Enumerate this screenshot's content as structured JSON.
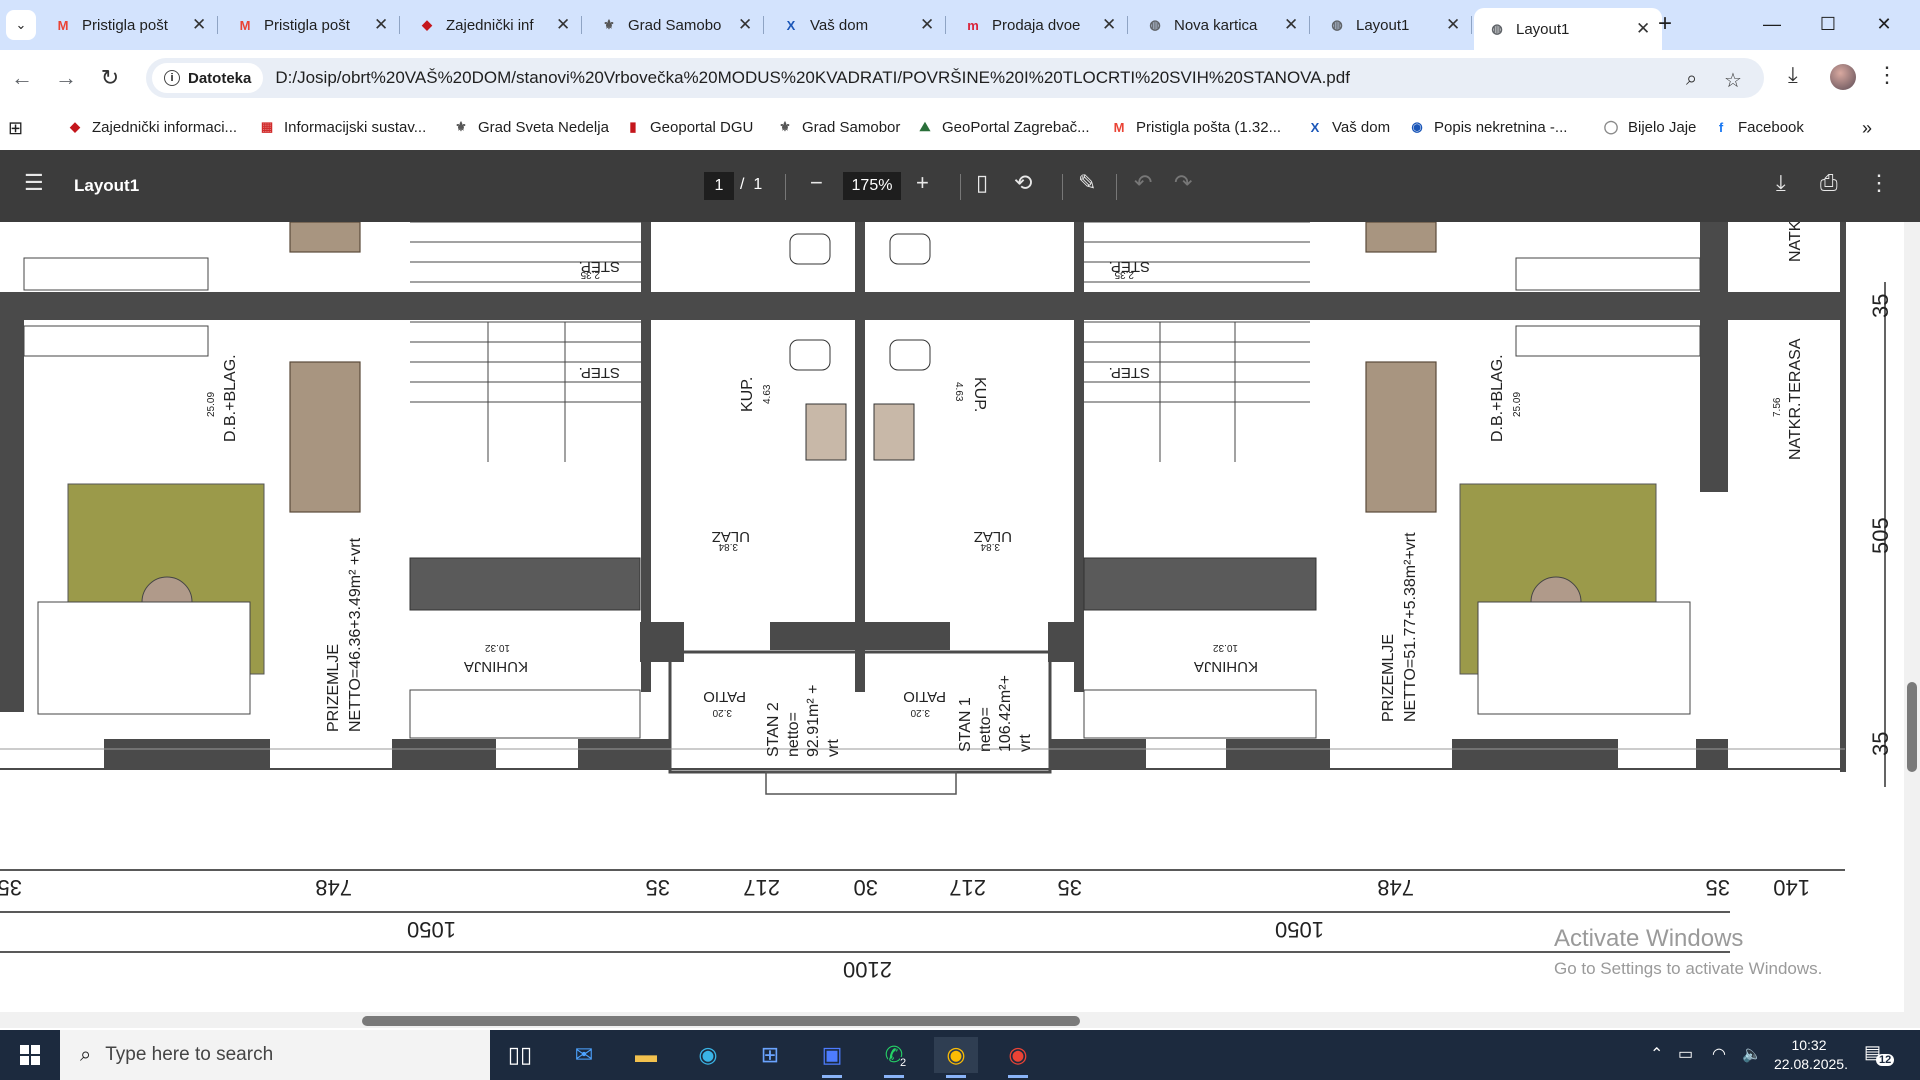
{
  "browser": {
    "tabs": [
      {
        "title": "Pristigla pošt",
        "icon": "gmail-icon",
        "color": "#ea4335"
      },
      {
        "title": "Pristigla pošt",
        "icon": "gmail-icon",
        "color": "#ea4335"
      },
      {
        "title": "Zajednički inf",
        "icon": "document-icon",
        "color": "#c4161c"
      },
      {
        "title": "Grad Samobo",
        "icon": "crest-icon",
        "color": "#555555"
      },
      {
        "title": "Vaš dom",
        "icon": "x-logo-icon",
        "color": "#1a56b8"
      },
      {
        "title": "Prodaja dvoe",
        "icon": "m-logo-icon",
        "color": "#d9233a"
      },
      {
        "title": "Nova kartica",
        "icon": "globe-icon",
        "color": "#5f6368"
      },
      {
        "title": "Layout1",
        "icon": "globe-icon",
        "color": "#5f6368"
      },
      {
        "title": "Layout1",
        "icon": "globe-icon",
        "color": "#5f6368",
        "active": true
      }
    ],
    "address": {
      "scheme_label": "Datoteka",
      "url": "D:/Josip/obrt%20VAŠ%20DOM/stanovi%20Vrbovečka%20MODUS%20KVADRATI/POVRŠINE%20I%20TLOCRTI%20SVIH%20STANOVA.pdf"
    },
    "bookmarks": [
      {
        "label": "Zajednički informaci...",
        "icon": "document-icon",
        "color": "#c4161c"
      },
      {
        "label": "Informacijski sustav...",
        "icon": "checkered-icon",
        "color": "#d12b2b"
      },
      {
        "label": "Grad Sveta Nedelja",
        "icon": "crest-icon",
        "color": "#555555"
      },
      {
        "label": "Geoportal DGU",
        "icon": "flag-icon",
        "color": "#c4161c"
      },
      {
        "label": "Grad Samobor",
        "icon": "crest-icon",
        "color": "#555555"
      },
      {
        "label": "GeoPortal Zagrebač...",
        "icon": "map-icon",
        "color": "#2a6f3a"
      },
      {
        "label": "Pristigla pošta (1.32...",
        "icon": "gmail-icon",
        "color": "#ea4335"
      },
      {
        "label": "Vaš dom",
        "icon": "x-logo-icon",
        "color": "#1a56b8"
      },
      {
        "label": "Popis nekretnina -...",
        "icon": "location-icon",
        "color": "#1a56b8"
      },
      {
        "label": "Bijelo Jaje",
        "icon": "egg-icon",
        "color": "#8a8a8a"
      },
      {
        "label": "Facebook",
        "icon": "facebook-icon",
        "color": "#1877f2"
      }
    ]
  },
  "pdf": {
    "title": "Layout1",
    "page_current": "1",
    "page_sep": "/",
    "page_total": "1",
    "zoom": "175%"
  },
  "plan": {
    "left_unit": {
      "stair_label": "STEP.",
      "stair_area": "2.35",
      "dining_label": "D.B.+BLAG.",
      "dining_area": "25.09",
      "bath_label": "KUP.",
      "bath_area": "4.63",
      "entry_label": "ULAZ",
      "entry_area": "3.84",
      "kitchen_label": "KUHINJA",
      "kitchen_area": "10.32",
      "patio_label": "PATIO",
      "patio_area": "3.20",
      "floor_label": "PRIZEMLJE",
      "netto": "NETTO=46.36+3.49m² +vrt",
      "stan_name": "STAN 2",
      "stan_netto": "netto=",
      "stan_area": "92.91m² +",
      "stan_vrt": "vrt"
    },
    "right_unit": {
      "stair_label": "STEP.",
      "stair_area": "2.35",
      "dining_label": "D.B.+BLAG.",
      "dining_area": "25.09",
      "bath_label": "KUP.",
      "bath_area": "4.63",
      "entry_label": "ULAZ",
      "entry_area": "3.84",
      "kitchen_label": "KUHINJA",
      "kitchen_area": "10.32",
      "patio_label": "PATIO",
      "patio_area": "3.20",
      "floor_label": "PRIZEMLJE",
      "netto": "NETTO=51.77+5.38m²+vrt",
      "stan_name": "STAN 1",
      "stan_netto": "netto=",
      "stan_area": "106.42m²+",
      "stan_vrt": "vrt",
      "terrace_label": "NATKR.TERASA",
      "terrace_area": "7.56",
      "terrace_top": "NATKR."
    },
    "dims_row1": [
      "35",
      "748",
      "35",
      "217",
      "30",
      "217",
      "35",
      "748",
      "35",
      "140"
    ],
    "dims_row2": [
      "1050",
      "1050"
    ],
    "dims_row3": [
      "2100"
    ],
    "dims_right": [
      "35",
      "505",
      "35"
    ]
  },
  "overlay": {
    "activate_title": "Activate Windows",
    "activate_sub": "Go to Settings to activate Windows."
  },
  "taskbar": {
    "search_placeholder": "Type here to search",
    "time": "10:32",
    "date": "22.08.2025.",
    "whatsapp_badge": "2",
    "notification_count": "12"
  }
}
